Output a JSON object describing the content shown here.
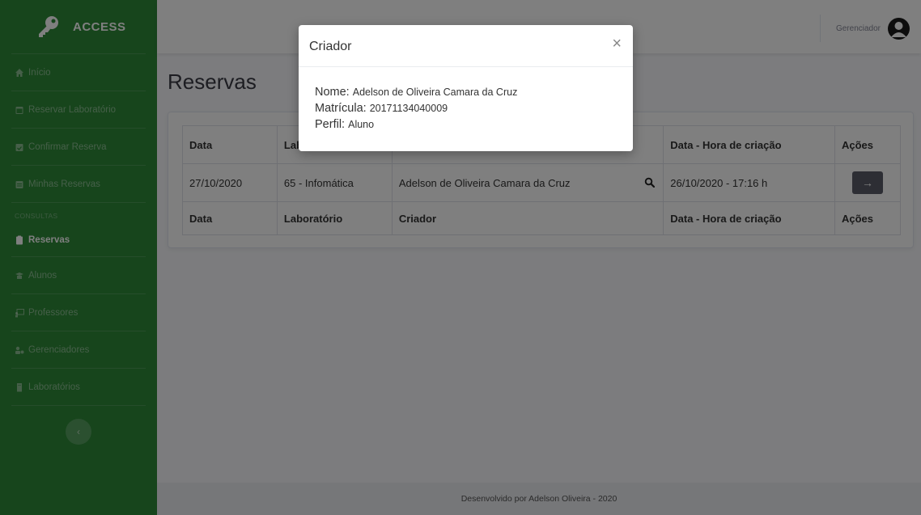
{
  "brand": {
    "name": "ACCESS",
    "icon": "key-icon"
  },
  "sidebar": {
    "items": [
      {
        "label": "Início",
        "icon": "home-icon"
      },
      {
        "label": "Reservar Laboratório",
        "icon": "calendar-icon"
      },
      {
        "label": "Confirmar Reserva",
        "icon": "calendar-check-icon"
      },
      {
        "label": "Minhas Reservas",
        "icon": "calendar-list-icon"
      }
    ],
    "section_heading": "Consultas",
    "consultas": [
      {
        "label": "Reservas",
        "icon": "clipboard-icon",
        "active": true
      },
      {
        "label": "Alunos",
        "icon": "graduation-icon"
      },
      {
        "label": "Professores",
        "icon": "chalkboard-teacher-icon"
      },
      {
        "label": "Gerenciadores",
        "icon": "users-cog-icon"
      },
      {
        "label": "Laboratórios",
        "icon": "building-icon"
      }
    ],
    "toggle_glyph": "‹"
  },
  "topbar": {
    "user_label": "Gerenciador",
    "avatar_icon": "user-circle-icon"
  },
  "page": {
    "title": "Reservas"
  },
  "table": {
    "headers": [
      "Data",
      "Laboratório",
      "Criador",
      "Data - Hora de criação",
      "Ações"
    ],
    "rows": [
      {
        "data": "27/10/2020",
        "laboratorio": "65 - Infomática",
        "criador": "Adelson de Oliveira Camara da Cruz",
        "criacao": "26/10/2020 - 17:16 h",
        "action_glyph": "→"
      }
    ]
  },
  "footer": {
    "text": "Desenvolvido por Adelson Oliveira - 2020"
  },
  "modal": {
    "title": "Criador",
    "close_glyph": "×",
    "nome_label": "Nome:",
    "nome_value": "Adelson de Oliveira Camara da Cruz",
    "matricula_label": "Matrícula:",
    "matricula_value": "20171134040009",
    "perfil_label": "Perfil:",
    "perfil_value": "Aluno"
  },
  "colors": {
    "sidebar": "#2e8a39",
    "action_button": "#5a5c69"
  }
}
